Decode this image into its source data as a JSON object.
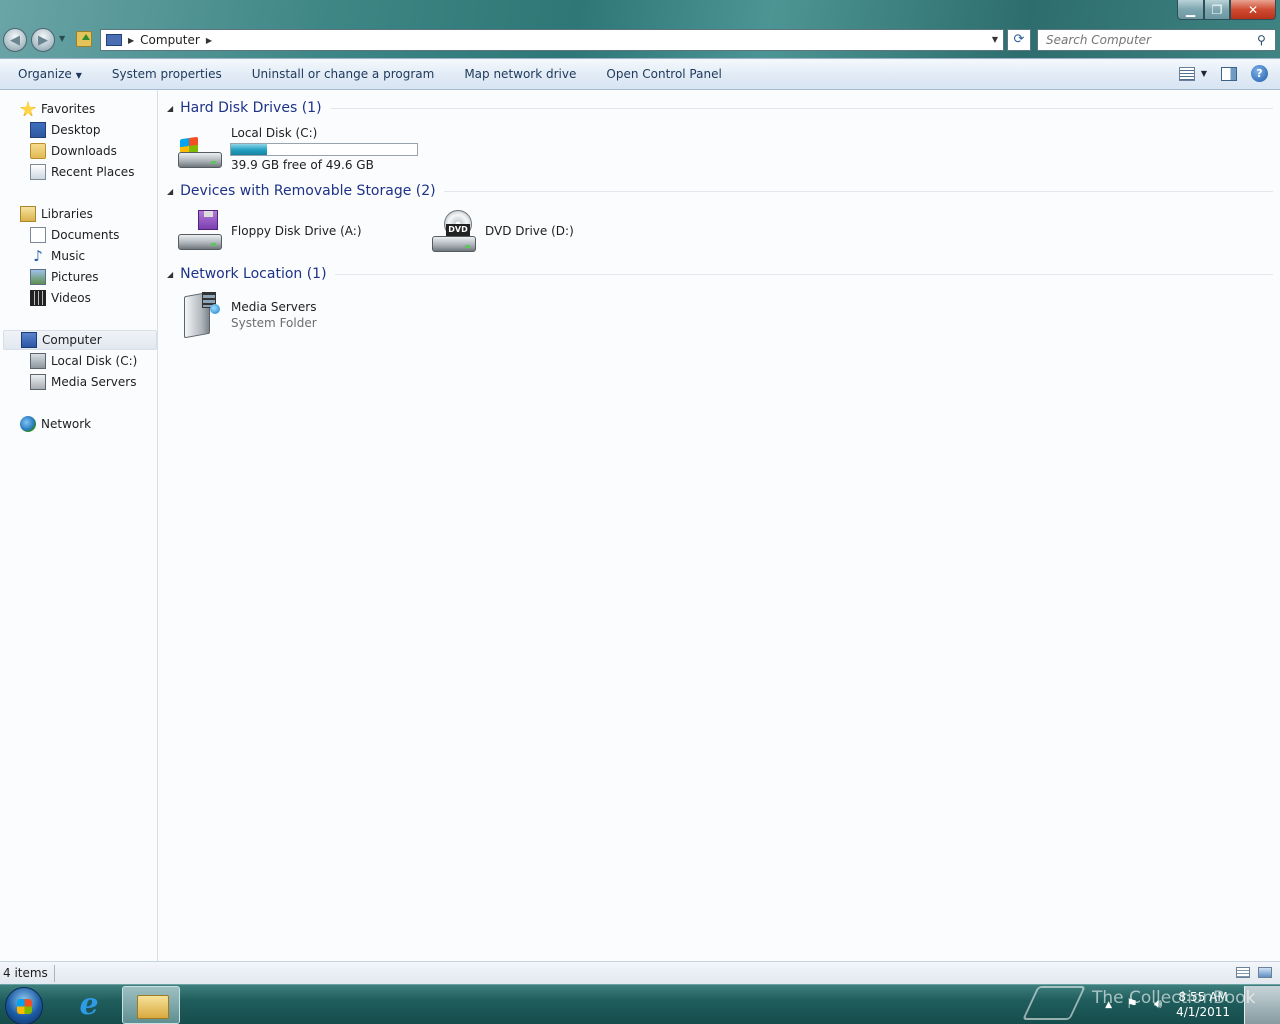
{
  "window": {
    "title": "Computer",
    "caption": {
      "minimize": "▁",
      "maximize": "❐",
      "close": "✕"
    }
  },
  "addressbar": {
    "breadcrumb": [
      "Computer"
    ],
    "search_placeholder": "Search Computer"
  },
  "toolbar": {
    "items": [
      {
        "label": "Organize",
        "has_dropdown": true
      },
      {
        "label": "System properties"
      },
      {
        "label": "Uninstall or change a program"
      },
      {
        "label": "Map network drive"
      },
      {
        "label": "Open Control Panel"
      }
    ],
    "help": "?"
  },
  "navpane": {
    "favorites": {
      "label": "Favorites",
      "items": [
        "Desktop",
        "Downloads",
        "Recent Places"
      ]
    },
    "libraries": {
      "label": "Libraries",
      "items": [
        "Documents",
        "Music",
        "Pictures",
        "Videos"
      ]
    },
    "computer": {
      "label": "Computer",
      "items": [
        "Local Disk (C:)",
        "Media Servers"
      ]
    },
    "network": {
      "label": "Network"
    }
  },
  "content": {
    "groups": [
      {
        "title": "Hard Disk Drives (1)",
        "items": [
          {
            "name": "Local Disk (C:)",
            "detail": "39.9 GB free of 49.6 GB",
            "used_fraction": 0.196
          }
        ]
      },
      {
        "title": "Devices with Removable Storage (2)",
        "items": [
          {
            "name": "Floppy Disk Drive (A:)"
          },
          {
            "name": "DVD Drive (D:)",
            "badge": "DVD"
          }
        ]
      },
      {
        "title": "Network Location (1)",
        "items": [
          {
            "name": "Media Servers",
            "detail": "System Folder"
          }
        ]
      }
    ]
  },
  "statusbar": {
    "count": "4 items"
  },
  "taskbar": {
    "ie_glyph": "e",
    "clock_time": "8:55 AM",
    "clock_date": "4/1/2011"
  },
  "watermark": "The CollectionBook",
  "colors": {
    "group_title": "#1e3287",
    "toolbar_text": "#1e395b",
    "usage_fill": "#27a3c4"
  }
}
